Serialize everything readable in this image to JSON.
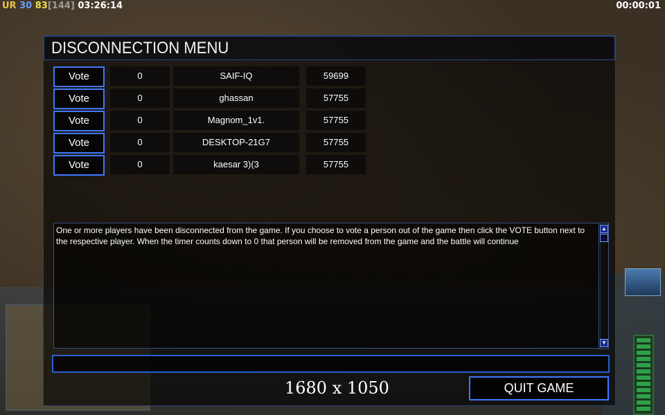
{
  "hud": {
    "faction": "UR",
    "value_blue": "30",
    "value_yellow": "83",
    "value_bracket": "[144]",
    "time_left": "03:26:14",
    "time_right": "00:00:01"
  },
  "dialog": {
    "title": "DISCONNECTION MENU",
    "players": [
      {
        "vote_label": "Vote",
        "count": "0",
        "name": "SAIF-IQ",
        "ping": "59699"
      },
      {
        "vote_label": "Vote",
        "count": "0",
        "name": "ghassan",
        "ping": "57755"
      },
      {
        "vote_label": "Vote",
        "count": "0",
        "name": "Magnom_1v1.",
        "ping": "57755"
      },
      {
        "vote_label": "Vote",
        "count": "0",
        "name": "DESKTOP-21G7",
        "ping": "57755"
      },
      {
        "vote_label": "Vote",
        "count": "0",
        "name": "kaesar 3)(3",
        "ping": "57755"
      }
    ],
    "message": "One or more players have been disconnected from the game. If you choose to vote a person out of the game then click the VOTE button  next to the respective player. When the timer counts down to 0 that person will be removed from the game and the battle will continue",
    "quit_label": "QUIT GAME",
    "resolution_label": "1680 x 1050"
  },
  "colors": {
    "accent": "#3f78ff",
    "title_border": "#2a4a8a"
  }
}
